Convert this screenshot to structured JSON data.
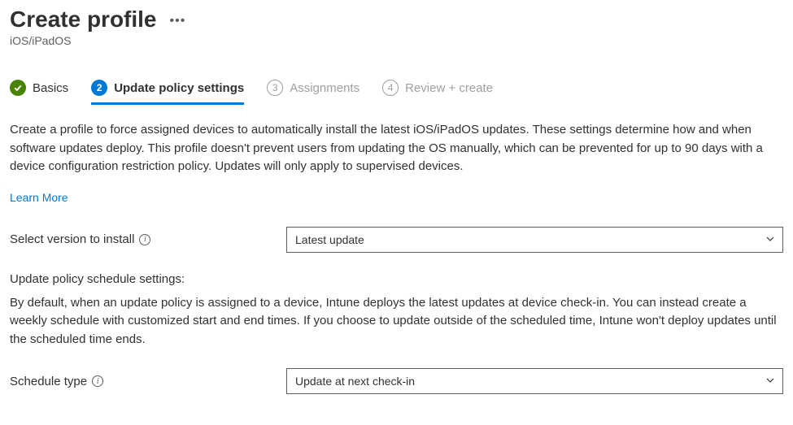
{
  "header": {
    "title": "Create profile",
    "subtitle": "iOS/iPadOS"
  },
  "tabs": [
    {
      "label": "Basics",
      "status": "complete"
    },
    {
      "label": "Update policy settings",
      "status": "active",
      "num": "2"
    },
    {
      "label": "Assignments",
      "status": "disabled",
      "num": "3"
    },
    {
      "label": "Review + create",
      "status": "disabled",
      "num": "4"
    }
  ],
  "description": "Create a profile to force assigned devices to automatically install the latest iOS/iPadOS updates. These settings determine how and when software updates deploy. This profile doesn't prevent users from updating the OS manually, which can be prevented for up to 90 days with a device configuration restriction policy. Updates will only apply to supervised devices.",
  "learn_more": "Learn More",
  "fields": {
    "version": {
      "label": "Select version to install",
      "value": "Latest update"
    },
    "schedule_heading": "Update policy schedule settings:",
    "schedule_desc": "By default, when an update policy is assigned to a device, Intune deploys the latest updates at device check-in. You can instead create a weekly schedule with customized start and end times. If you choose to update outside of the scheduled time, Intune won't deploy updates until the scheduled time ends.",
    "schedule_type": {
      "label": "Schedule type",
      "value": "Update at next check-in"
    }
  }
}
